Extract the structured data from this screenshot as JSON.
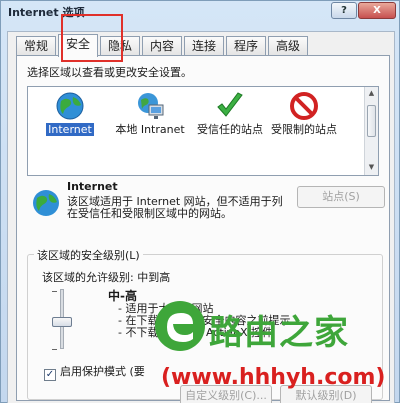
{
  "window": {
    "title": "Internet 选项",
    "help_label": "?",
    "close_label": "X"
  },
  "tabs": [
    {
      "label": "常规",
      "active": false
    },
    {
      "label": "安全",
      "active": true
    },
    {
      "label": "隐私",
      "active": false
    },
    {
      "label": "内容",
      "active": false
    },
    {
      "label": "连接",
      "active": false
    },
    {
      "label": "程序",
      "active": false
    },
    {
      "label": "高级",
      "active": false
    }
  ],
  "security": {
    "instruction": "选择区域以查看或更改安全设置。",
    "zones": [
      {
        "label": "Internet",
        "icon": "globe-icon",
        "selected": true
      },
      {
        "label": "本地 Intranet",
        "icon": "intranet-icon",
        "selected": false
      },
      {
        "label": "受信任的站点",
        "icon": "check-icon",
        "selected": false
      },
      {
        "label": "受限制的站点",
        "icon": "no-entry-icon",
        "selected": false
      }
    ],
    "selected_zone": {
      "title": "Internet",
      "description": "该区域适用于 Internet 网站，但不适用于列在受信任和受限制区域中的网站。"
    },
    "sites_button": "站点(S)",
    "level_group_title": "该区域的安全级别(L)",
    "allowed_levels": "该区域的允许级别: 中到高",
    "level_name": "中-高",
    "level_points": [
      "适用于大多数网站",
      "在下载潜在的不安全内容之前提示",
      "不下载未签名的 ActiveX 控件"
    ],
    "protected_mode": {
      "label": "启用保护模式 (要",
      "checked": true
    },
    "custom_level_button": "自定义级别(C)...",
    "default_level_button": "默认级别(D)"
  },
  "watermark": {
    "brand": "路由之家",
    "url": "(www.hhhyh.com)"
  },
  "colors": {
    "selection": "#316ac5",
    "highlight_box": "#e0302a",
    "watermark_green": "#3ea63a",
    "watermark_red": "#d9201f"
  }
}
